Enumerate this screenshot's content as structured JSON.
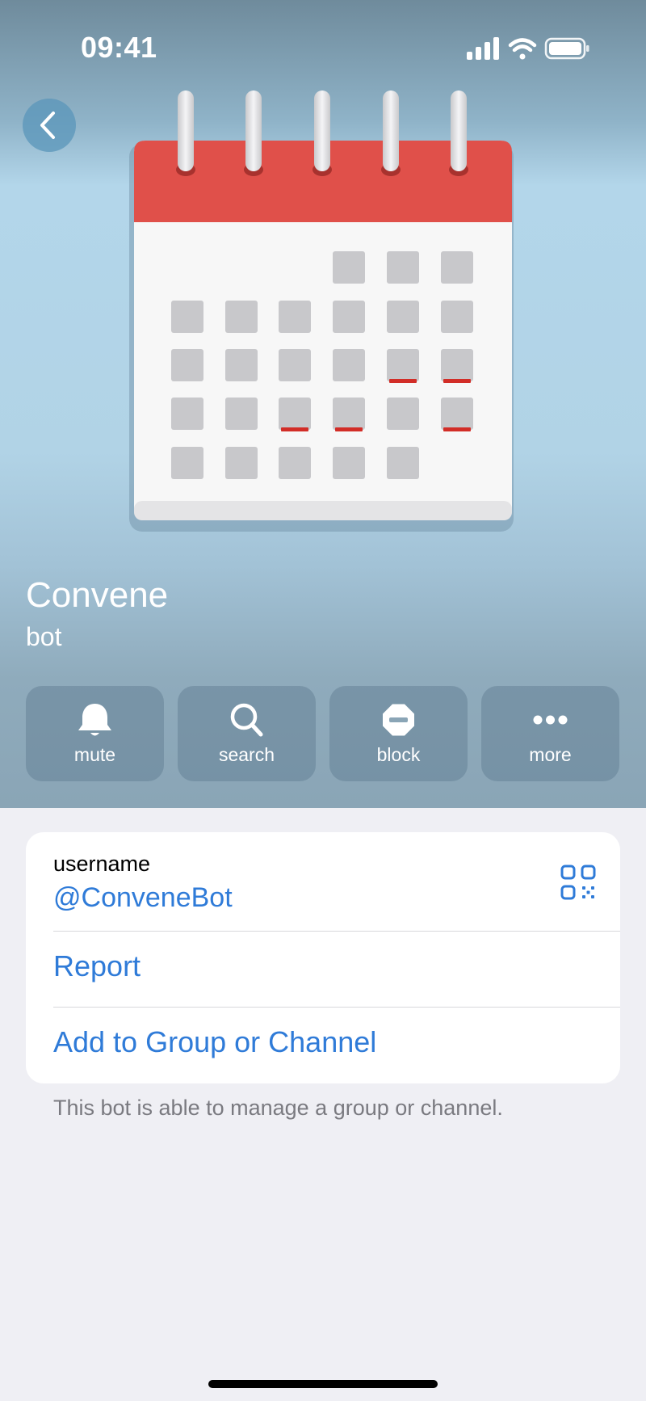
{
  "status": {
    "time": "09:41"
  },
  "profile": {
    "name": "Convene",
    "subtitle": "bot"
  },
  "actions": [
    {
      "label": "mute",
      "icon": "bell-icon"
    },
    {
      "label": "search",
      "icon": "search-icon"
    },
    {
      "label": "block",
      "icon": "block-icon"
    },
    {
      "label": "more",
      "icon": "more-icon"
    }
  ],
  "info": {
    "username_label": "username",
    "username_value": "@ConveneBot",
    "report_label": "Report",
    "add_label": "Add to Group or Channel",
    "footnote": "This bot is able to manage a group or channel."
  },
  "colors": {
    "accent": "#2f7bd8",
    "calendar_header": "#e0504a",
    "calendar_mark": "#d22d27",
    "background": "#efeff4"
  }
}
